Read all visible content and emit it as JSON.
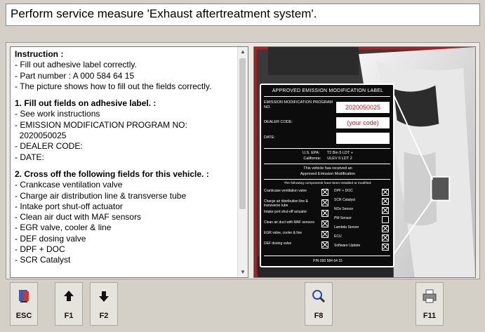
{
  "title": "Perform service measure 'Exhaust aftertreatment system'.",
  "instructions": {
    "lines": [
      {
        "text": "Instruction :",
        "bold": true
      },
      {
        "text": "- Fill out adhesive label correctly."
      },
      {
        "text": "- Part number : A 000 584 64 15"
      },
      {
        "text": "- The picture shows how to fill out the fields correctly."
      },
      {
        "text": "",
        "gap": true
      },
      {
        "text": "1. Fill out fields on adhesive label. :",
        "bold": true
      },
      {
        "text": "- See work instructions"
      },
      {
        "text": "- EMISSION MODIFICATION PROGRAM NO:"
      },
      {
        "text": "  2020050025"
      },
      {
        "text": "- DEALER CODE:"
      },
      {
        "text": "- DATE:"
      },
      {
        "text": "",
        "gap": true
      },
      {
        "text": "2. Cross off the following fields for this vehicle. :",
        "bold": true
      },
      {
        "text": "- Crankcase ventilation valve"
      },
      {
        "text": "- Charge air distribution line & transverse tube"
      },
      {
        "text": "- Intake port shut-off actuator"
      },
      {
        "text": "- Clean air duct with MAF sensors"
      },
      {
        "text": "- EGR valve, cooler & line"
      },
      {
        "text": "- DEF dosing valve"
      },
      {
        "text": "- DPF + DOC"
      },
      {
        "text": "- SCR Catalyst"
      }
    ]
  },
  "label": {
    "title": "APPROVED EMISSION MODIFICATION LABEL",
    "program_label": "EMISSION MODIFICATION PROGRAM NO.",
    "program_value": "2020050025",
    "dealer_label": "DEALER CODE:",
    "dealer_value": "(your code)",
    "date_label": "DATE:",
    "epa_line": "U.S. EPA:       T2 Bin 5 LDT +",
    "calif_line": "California:      ULEV II LDT 2",
    "install_line1": "This vehicle has received an",
    "install_line2": "Approved Emission Modification",
    "components_intro": "The following components have been installed or modified:",
    "left_items": [
      {
        "text": "Crankcase ventilation valve",
        "checked": true
      },
      {
        "text": "Charge air distribution line & transverse tube",
        "checked": true
      },
      {
        "text": "Intake port shut-off actuator",
        "checked": true
      },
      {
        "text": "Clean air duct with MAF sensors",
        "checked": true
      },
      {
        "text": "EGR valve, cooler & line",
        "checked": true
      },
      {
        "text": "DEF dosing valve",
        "checked": true
      }
    ],
    "right_items": [
      {
        "text": "DPF + DOC",
        "checked": true
      },
      {
        "text": "SCR Catalyst",
        "checked": true
      },
      {
        "text": "NOx Sensor",
        "checked": true
      },
      {
        "text": "PM Sensor",
        "checked": false
      },
      {
        "text": "Lambda Sensor",
        "checked": true
      },
      {
        "text": "ECU",
        "checked": true
      },
      {
        "text": "Software Update",
        "checked": true
      }
    ],
    "footer": "P/N 000 584 64 15"
  },
  "toolbar": [
    {
      "key": "ESC",
      "icon": "exit-door-icon"
    },
    {
      "key": "F1",
      "icon": "arrow-up-icon"
    },
    {
      "key": "F2",
      "icon": "arrow-down-icon"
    },
    {
      "key": "F8",
      "icon": "magnifier-icon"
    },
    {
      "key": "F11",
      "icon": "printer-icon"
    }
  ],
  "colors": {
    "label_red": "#c4161c",
    "frame_border": "#c4161c",
    "background": "#d4d0c8"
  }
}
